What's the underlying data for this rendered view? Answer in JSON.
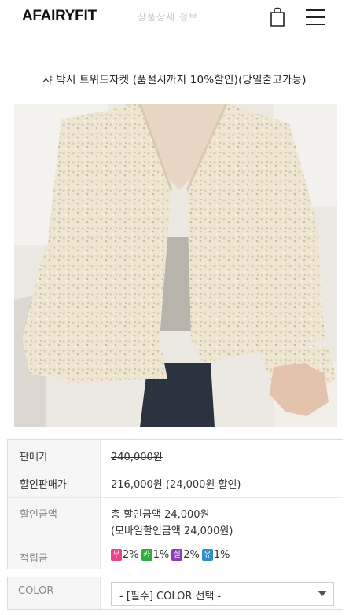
{
  "header": {
    "logo": "AFAIRYFIT",
    "subtitle": "상품상세 정보",
    "cart_icon": "shopping-bag-icon",
    "menu_icon": "hamburger-menu-icon"
  },
  "product": {
    "title": "샤 박시 트위드자켓 (품절시까지 10%할인)(당일출고가능)"
  },
  "price_info": {
    "price_label": "판매가",
    "price_value": "240,000원",
    "sale_label": "할인판매가",
    "sale_value": "216,000원 (24,000원 할인)",
    "discount_label": "할인금액",
    "discount_total": "총 할인금액 24,000원",
    "discount_mobile": "(모바일할인금액 24,000원)",
    "reward_label": "적립금",
    "rewards": [
      {
        "badge": "무",
        "color": "#e9418a",
        "text": "2%"
      },
      {
        "badge": "카",
        "color": "#2fae3b",
        "text": "1%"
      },
      {
        "badge": "실",
        "color": "#8a3fb8",
        "text": "2%"
      },
      {
        "badge": "유",
        "color": "#2b8fd0",
        "text": "1%"
      }
    ]
  },
  "option": {
    "label": "COLOR",
    "select_value": "- [필수] COLOR 선택 -"
  }
}
